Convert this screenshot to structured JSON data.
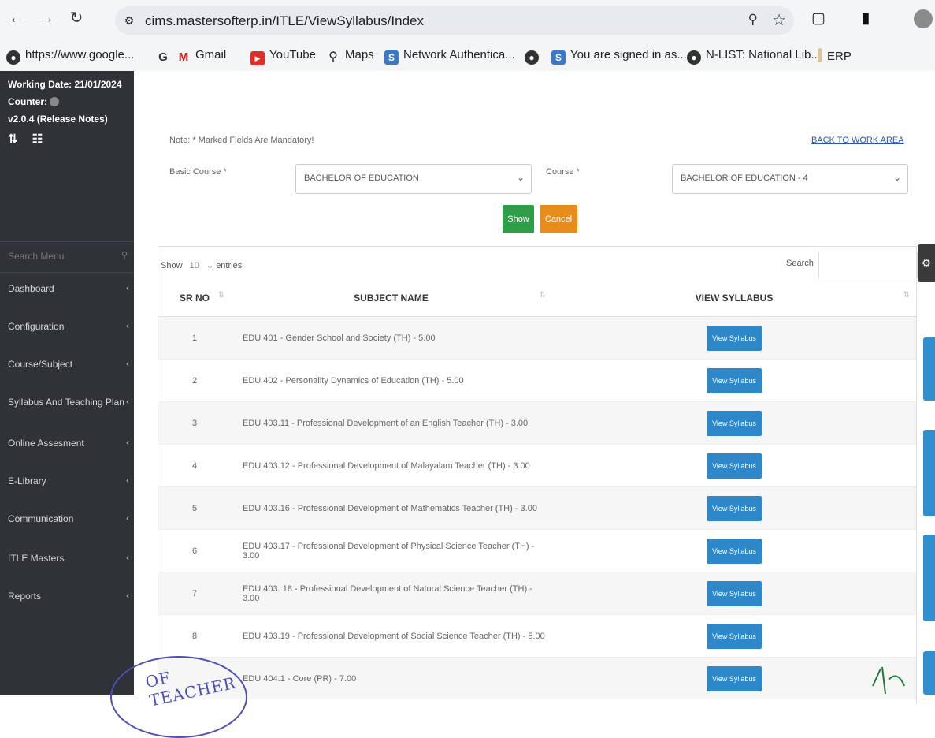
{
  "browser": {
    "url": "cims.mastersofterp.in/ITLE/ViewSyllabus/Index",
    "bookmarks": [
      {
        "label": "https://www.google...",
        "icon": "globe-icon"
      },
      {
        "label": "",
        "icon": "google-icon"
      },
      {
        "label": "Gmail",
        "icon": "gmail-icon"
      },
      {
        "label": "YouTube",
        "icon": "youtube-icon"
      },
      {
        "label": "Maps",
        "icon": "maps-pin-icon"
      },
      {
        "label": "Network Authentica...",
        "icon": "s-app-icon"
      },
      {
        "label": "",
        "icon": "globe-icon"
      },
      {
        "label": "You are signed in as...",
        "icon": "s-app-icon"
      },
      {
        "label": "N-LIST: National Lib...",
        "icon": "globe-icon"
      },
      {
        "label": "ERP",
        "icon": "folder-icon"
      }
    ]
  },
  "sidebar": {
    "working_date": "Working Date: 21/01/2024",
    "counter": "Counter:",
    "version": "v2.0.4 (Release Notes)",
    "search_placeholder": "Search Menu",
    "items": [
      {
        "label": "Dashboard"
      },
      {
        "label": "Configuration"
      },
      {
        "label": "Course/Subject"
      },
      {
        "label": "Syllabus And Teaching Plan"
      },
      {
        "label": "Online Assesment"
      },
      {
        "label": "E-Library"
      },
      {
        "label": "Communication"
      },
      {
        "label": "ITLE Masters"
      },
      {
        "label": "Reports"
      }
    ]
  },
  "form": {
    "note": "Note: * Marked Fields Are Mandatory!",
    "back_link": "BACK TO WORK AREA",
    "basic_course_label": "Basic Course *",
    "basic_course_value": "BACHELOR OF EDUCATION",
    "course_label": "Course *",
    "course_value": "BACHELOR OF EDUCATION - 4",
    "show_label": "Show",
    "cancel_label": "Cancel"
  },
  "table": {
    "show_label": "Show",
    "entries_value": "10",
    "entries_label": "entries",
    "search_label": "Search",
    "headers": [
      "SR NO",
      "SUBJECT NAME",
      "VIEW SYLLABUS"
    ],
    "view_button_label": "View Syllabus",
    "rows": [
      {
        "sr": "1",
        "subject": "EDU 401 - Gender School and Society (TH) - 5.00"
      },
      {
        "sr": "2",
        "subject": "EDU 402 - Personality Dynamics of Education (TH) - 5.00"
      },
      {
        "sr": "3",
        "subject": "EDU 403.11 - Professional Development of an English Teacher (TH) - 3.00"
      },
      {
        "sr": "4",
        "subject": "EDU 403.12 - Professional Development of Malayalam Teacher (TH) - 3.00"
      },
      {
        "sr": "5",
        "subject": "EDU 403.16 - Professional Development of Mathematics Teacher (TH) - 3.00"
      },
      {
        "sr": "6",
        "subject": "EDU 403.17 - Professional Development of Physical Science Teacher (TH) - 3.00"
      },
      {
        "sr": "7",
        "subject": "EDU 403. 18 - Professional Development of Natural Science Teacher (TH) - 3.00"
      },
      {
        "sr": "8",
        "subject": "EDU 403.19 - Professional Development of Social Science Teacher (TH) - 5.00"
      },
      {
        "sr": "",
        "subject": "EDU 404.1 - Core (PR) - 7.00"
      }
    ]
  },
  "stamp_text": "OF TEACHER"
}
